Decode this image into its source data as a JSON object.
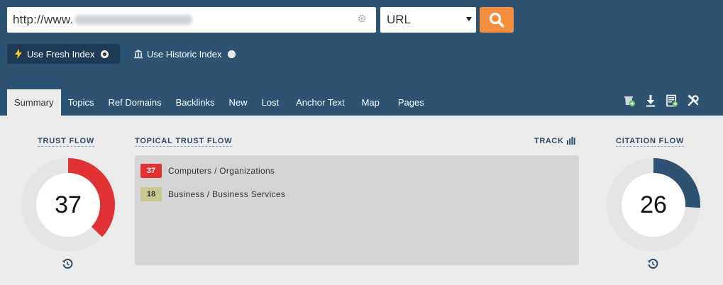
{
  "search": {
    "url_prefix": "http://www.",
    "type_selected": "URL"
  },
  "index_options": {
    "fresh_label": "Use Fresh Index",
    "historic_label": "Use Historic Index",
    "selected": "fresh"
  },
  "tabs": [
    {
      "label": "Summary",
      "active": true
    },
    {
      "label": "Topics"
    },
    {
      "label": "Ref Domains"
    },
    {
      "label": "Backlinks"
    },
    {
      "label": "New"
    },
    {
      "label": "Lost"
    },
    {
      "label": "Anchor Text"
    },
    {
      "label": "Map"
    },
    {
      "label": "Pages"
    }
  ],
  "trust_flow": {
    "title": "TRUST FLOW",
    "value": 37,
    "color": "#e03232"
  },
  "topical_trust_flow": {
    "title": "TOPICAL TRUST FLOW",
    "track_label": "TRACK",
    "items": [
      {
        "value": "37",
        "label": "Computers / Organizations",
        "bg": "#e03232",
        "fg": "#ffffff"
      },
      {
        "value": "18",
        "label": "Business / Business Services",
        "bg": "#c8c890",
        "fg": "#333333"
      }
    ]
  },
  "citation_flow": {
    "title": "CITATION FLOW",
    "value": 26,
    "color": "#2e5372"
  },
  "colors": {
    "header_bg": "#2e5372",
    "accent": "#f68d3d",
    "gauge_track": "#e4e4e4"
  }
}
